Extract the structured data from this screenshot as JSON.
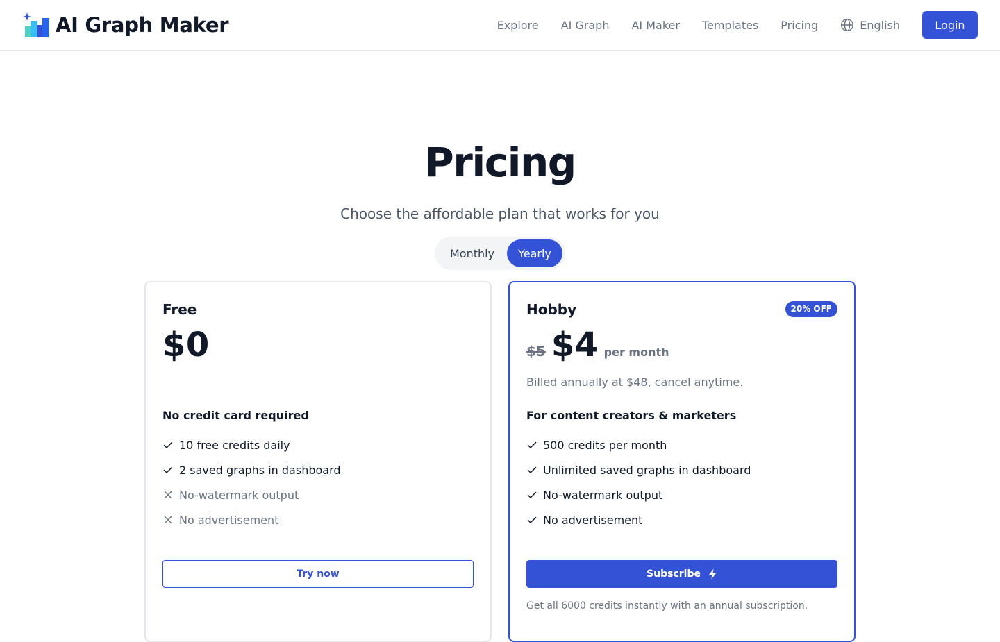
{
  "header": {
    "brand_name": "AI Graph Maker",
    "nav": [
      "Explore",
      "AI Graph",
      "AI Maker",
      "Templates",
      "Pricing"
    ],
    "language": "English",
    "login_label": "Login"
  },
  "hero": {
    "title": "Pricing",
    "subtitle": "Choose the affordable plan that works for you"
  },
  "billing_toggle": {
    "options": [
      "Monthly",
      "Yearly"
    ],
    "selected": "Yearly"
  },
  "plans": [
    {
      "name": "Free",
      "price": "$0",
      "tagline": "No credit card required",
      "features": [
        {
          "text": "10 free credits daily",
          "included": true
        },
        {
          "text": "2 saved graphs in dashboard",
          "included": true
        },
        {
          "text": "No-watermark output",
          "included": false
        },
        {
          "text": "No advertisement",
          "included": false
        }
      ],
      "cta_label": "Try now"
    },
    {
      "name": "Hobby",
      "badge": "20% OFF",
      "old_price": "$5",
      "price": "$4",
      "period": "per month",
      "billing_note": "Billed annually at $48, cancel anytime.",
      "tagline": "For content creators & marketers",
      "features": [
        {
          "text": "500 credits per month",
          "included": true
        },
        {
          "text": "Unlimited saved graphs in dashboard",
          "included": true
        },
        {
          "text": "No-watermark output",
          "included": true
        },
        {
          "text": "No advertisement",
          "included": true
        }
      ],
      "cta_label": "Subscribe",
      "footnote": "Get all 6000 credits instantly with an annual subscription."
    }
  ],
  "colors": {
    "accent": "#3352d6",
    "text_primary": "#111827",
    "text_muted": "#6b7280",
    "border": "#e5e7eb"
  },
  "icons": {
    "logo": "bar-chart-sparkle-icon",
    "language": "globe-icon",
    "included": "check-icon",
    "excluded": "x-icon",
    "subscribe": "lightning-icon"
  }
}
